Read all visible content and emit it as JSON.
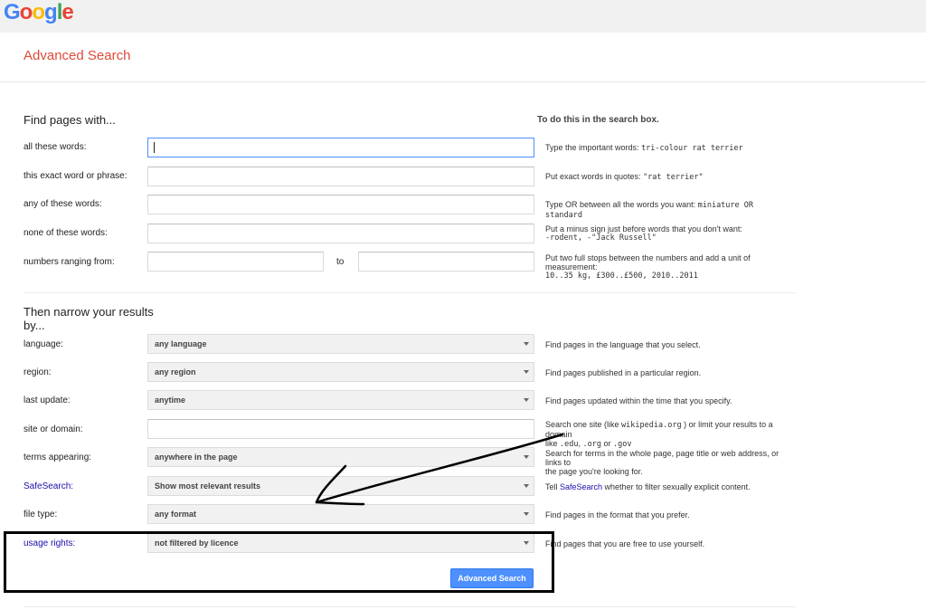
{
  "logo": {
    "letters": [
      "G",
      "o",
      "o",
      "g",
      "l",
      "e"
    ],
    "colors": [
      "#4285f4",
      "#ea4335",
      "#fbbc05",
      "#4285f4",
      "#34a853",
      "#ea4335"
    ]
  },
  "header": {
    "title": "Advanced Search"
  },
  "find": {
    "title": "Find pages with...",
    "hint_header": "To do this in the search box.",
    "rows": [
      {
        "label": "all these words:",
        "value": "",
        "hint_text": "Type the important words: ",
        "hint_mono": "tri-colour rat terrier"
      },
      {
        "label": "this exact word or phrase:",
        "value": "",
        "hint_text": "Put exact words in quotes: ",
        "hint_mono": "\"rat terrier\""
      },
      {
        "label": "any of these words:",
        "value": "",
        "hint_text": "Type OR between all the words you want: ",
        "hint_mono": "miniature OR standard"
      },
      {
        "label": "none of these words:",
        "value": "",
        "hint_text": "Put a minus sign just before words that you don't want:",
        "hint_mono": "-rodent, -\"Jack Russell\""
      },
      {
        "label": "numbers ranging from:",
        "to_label": "to",
        "value_from": "",
        "value_to": "",
        "hint_text": "Put two full stops between the numbers and add a unit of measurement:",
        "hint_mono": "10..35 kg, £300..£500, 2010..2011"
      }
    ]
  },
  "narrow": {
    "title_line1": "Then narrow your results",
    "title_line2": "by...",
    "rows": [
      {
        "label": "language:",
        "value": "any language",
        "hint": "Find pages in the language that you select."
      },
      {
        "label": "region:",
        "value": "any region",
        "hint": "Find pages published in a particular region."
      },
      {
        "label": "last update:",
        "value": "anytime",
        "hint": "Find pages updated within the time that you specify."
      },
      {
        "label": "site or domain:",
        "value": "",
        "hint_a": "Search one site (like ",
        "hint_mono_a": "wikipedia.org",
        "hint_b": " ) or limit your results to a domain",
        "hint_c": "like ",
        "hint_mono_b": ".edu",
        "hint_d": ", ",
        "hint_mono_c": ".org",
        "hint_e": " or ",
        "hint_mono_d": ".gov"
      },
      {
        "label": "terms appearing:",
        "value": "anywhere in the page",
        "hint_line1": "Search for terms in the whole page, page title or web address, or links to",
        "hint_line2": "the page you're looking for."
      },
      {
        "label": "SafeSearch:",
        "value": "Show most relevant results",
        "hint_a": "Tell ",
        "hint_link": "SafeSearch",
        "hint_b": " whether to filter sexually explicit content."
      },
      {
        "label": "file type:",
        "value": "any format",
        "hint": "Find pages in the format that you prefer."
      },
      {
        "label": "usage rights:",
        "value": "not filtered by licence",
        "hint": "Find pages that you are free to use yourself."
      }
    ]
  },
  "button": {
    "label": "Advanced Search"
  },
  "colors": {
    "accent_red": "#dd4b39",
    "link_blue": "#1a0dab",
    "button_blue": "#4d90fe"
  }
}
